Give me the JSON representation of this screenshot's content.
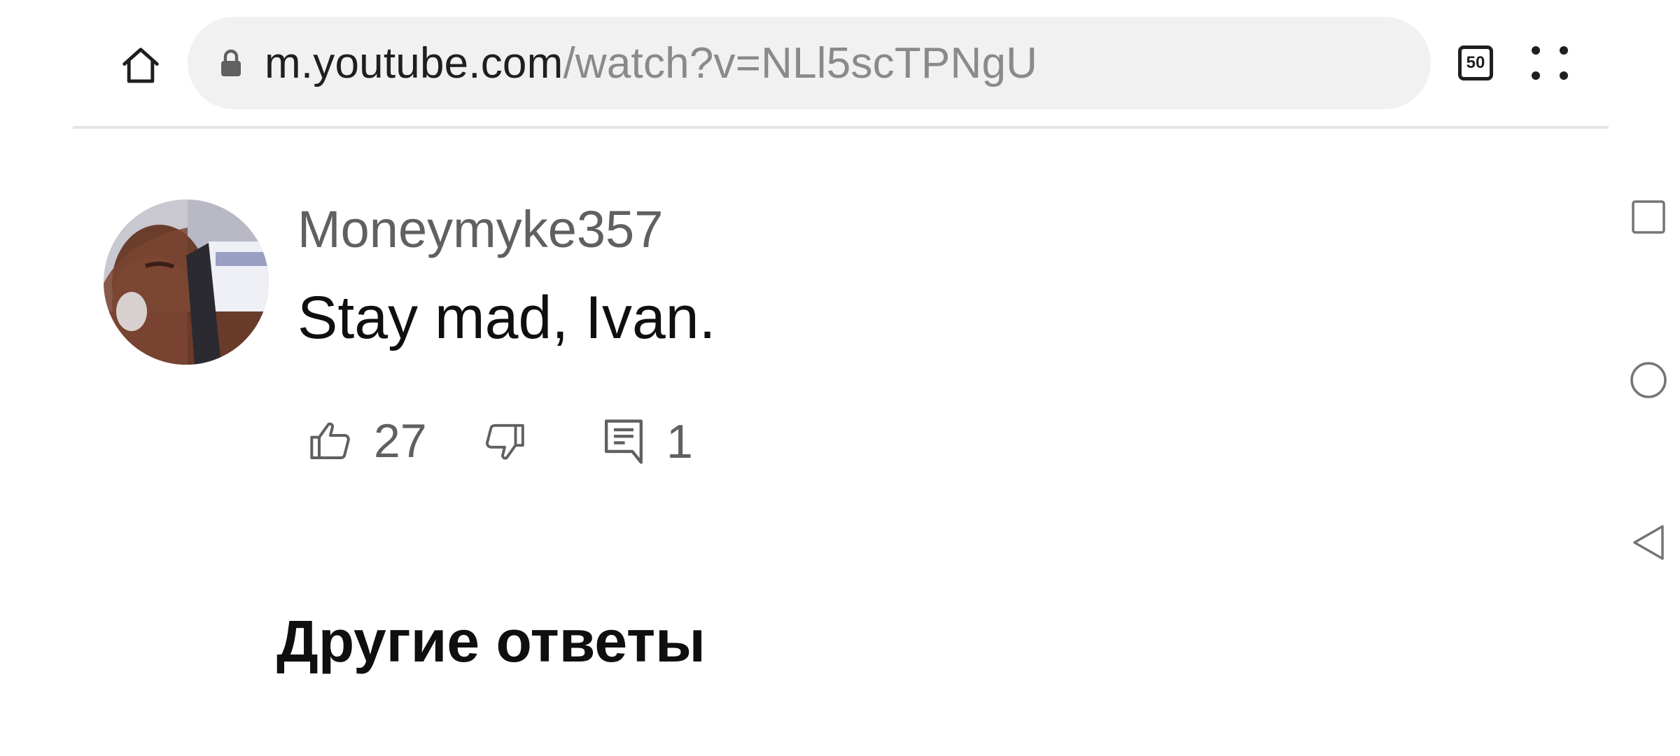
{
  "browser": {
    "url_host": "m.youtube.com",
    "url_path": "/watch?v=NLl5scTPNgU",
    "tab_count": "50",
    "icons": {
      "home": "home-icon",
      "lock": "lock-icon",
      "menu": "more-options-icon"
    }
  },
  "comment": {
    "author": "Moneymyke357",
    "text": "Stay mad, Ivan.",
    "likes": "27",
    "replies": "1"
  },
  "section": {
    "heading": "Другие ответы"
  },
  "navbar": {
    "icons": [
      "recents-icon",
      "home-circle-icon",
      "back-icon"
    ]
  },
  "colors": {
    "omnibox_bg": "#f1f1f1",
    "secondary_text": "#606060",
    "primary_text": "#0f0f0f"
  }
}
